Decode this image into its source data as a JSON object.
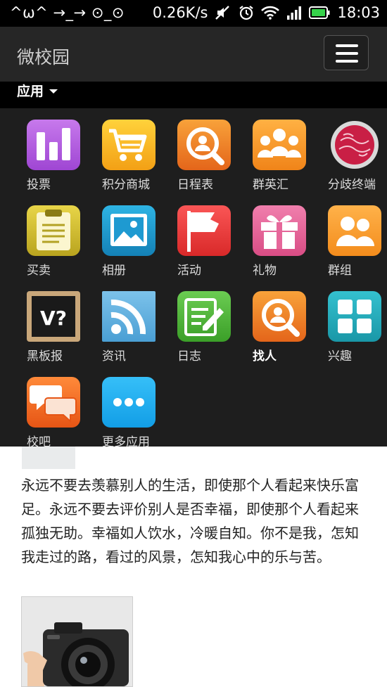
{
  "status_bar": {
    "left_text": "^ω^ →_→ ⊙_⊙",
    "speed": "0.26K/s",
    "time": "18:03",
    "icons": [
      "mute-icon",
      "alarm-icon",
      "wifi-icon",
      "signal-icon",
      "battery-icon"
    ]
  },
  "appbar": {
    "title": "微校园",
    "menu_icon": "hamburger-icon"
  },
  "dropdown": {
    "label": "应用"
  },
  "apps": [
    {
      "label": "投票",
      "icon": "bar-chart-icon",
      "color": "#b25fe0"
    },
    {
      "label": "积分商城",
      "icon": "shopping-cart-icon",
      "color": "#f7b21c"
    },
    {
      "label": "日程表",
      "icon": "search-person-icon",
      "color": "#f07c24"
    },
    {
      "label": "群英汇",
      "icon": "group-icon",
      "color": "#f49a25"
    },
    {
      "label": "分歧终端",
      "icon": "planet-icon",
      "color": "#d2284a"
    },
    {
      "label": "买卖",
      "icon": "notepad-icon",
      "color": "#c9b530"
    },
    {
      "label": "相册",
      "icon": "picture-icon",
      "color": "#1c9fcc"
    },
    {
      "label": "活动",
      "icon": "flag-icon",
      "color": "#ea3b3b"
    },
    {
      "label": "礼物",
      "icon": "gift-icon",
      "color": "#e9669a"
    },
    {
      "label": "群组",
      "icon": "group-icon",
      "color": "#f7a025"
    },
    {
      "label": "黑板报",
      "icon": "blackboard-icon",
      "color": "#3a2a1c"
    },
    {
      "label": "资讯",
      "icon": "rss-icon",
      "color": "#5aaedf"
    },
    {
      "label": "日志",
      "icon": "edit-icon",
      "color": "#4cb736"
    },
    {
      "label": "找人",
      "icon": "search-person-icon",
      "color": "#ee7b22",
      "bold": true
    },
    {
      "label": "兴趣",
      "icon": "tiles-icon",
      "color": "#27aebd"
    },
    {
      "label": "校吧",
      "icon": "chat-icon",
      "color": "#f06a24"
    },
    {
      "label": "更多应用",
      "icon": "more-icon",
      "color": "#21adf2"
    }
  ],
  "post": {
    "text": "永远不要去羡慕别人的生活，即使那个人看起来快乐富足。永远不要去评价别人是否幸福，即使那个人看起来孤独无助。幸福如人饮水，冷暖自知。你不是我，怎知我走过的路，看过的风景，怎知我心中的乐与苦。"
  },
  "photo": {
    "icon": "camera-photo"
  }
}
